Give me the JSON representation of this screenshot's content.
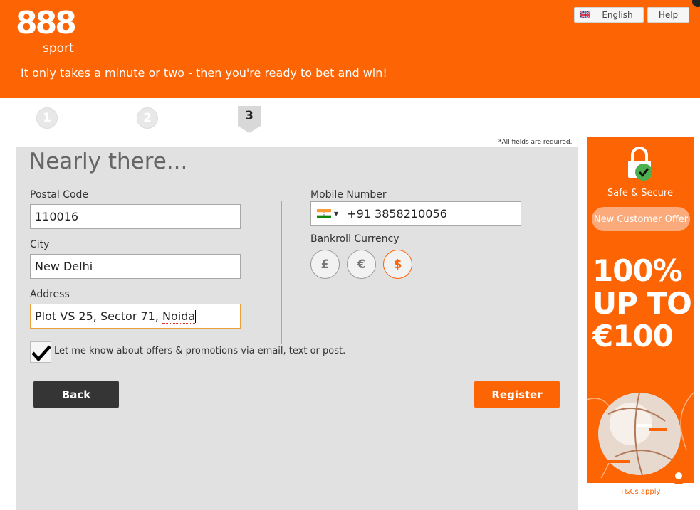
{
  "header": {
    "logo_number": "888",
    "logo_word": "sport",
    "tagline": "It only takes a minute or two - then you're ready to bet and win!",
    "language_label": "English",
    "help_label": "Help",
    "brand_color": "#fd6404"
  },
  "stepper": {
    "steps": [
      "1",
      "2",
      "3"
    ],
    "current": "3"
  },
  "form": {
    "required_note": "*All fields are required.",
    "title": "Nearly there...",
    "postal_code": {
      "label": "Postal Code",
      "value": "110016"
    },
    "city": {
      "label": "City",
      "value": "New Delhi"
    },
    "address": {
      "label": "Address",
      "value_prefix": "Plot VS 25, Sector 71, ",
      "value_misspelled": "Noida"
    },
    "mobile": {
      "label": "Mobile Number",
      "country_flag_icon": "india-flag-icon",
      "value": "+91 3858210056"
    },
    "currency": {
      "label": "Bankroll Currency",
      "options": [
        "£",
        "€",
        "$"
      ],
      "selected": "$"
    },
    "offers_checkbox": {
      "label": "Let me know about offers & promotions via email, text or post.",
      "checked": true
    },
    "back_label": "Back",
    "register_label": "Register"
  },
  "promo": {
    "safe_label": "Safe & Secure",
    "offer_label": "New Customer Offer",
    "line1": "100%",
    "line2": "UP TO",
    "line3": "€100",
    "tcs_label": "T&Cs apply"
  }
}
